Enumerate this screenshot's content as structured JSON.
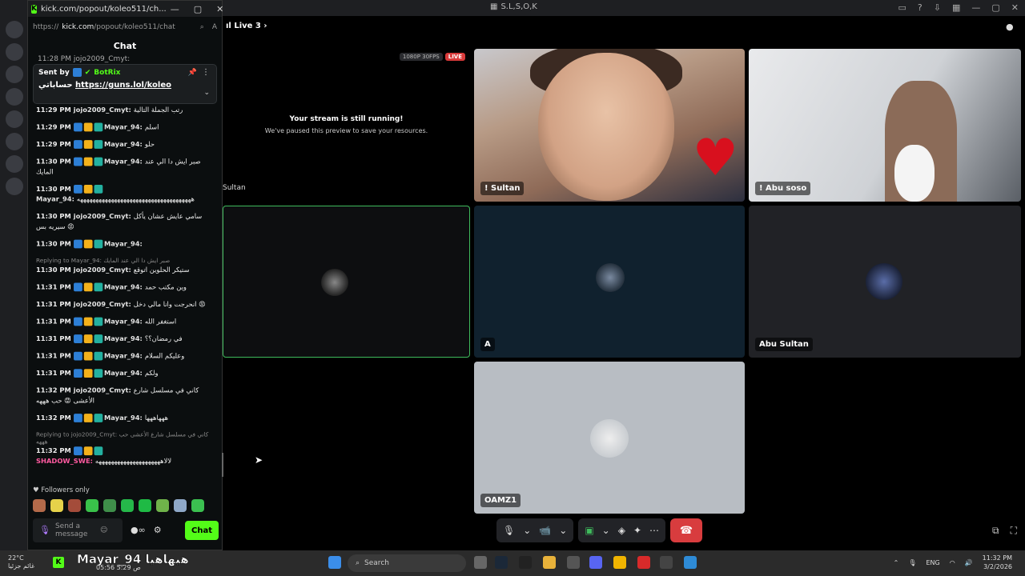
{
  "discord": {
    "window_title": "S.L,S,O,K",
    "channel": "Live 3",
    "stream": {
      "resolution": "1080P 30FPS",
      "live_badge": "LIVE",
      "paused_title": "Your stream is still running!",
      "paused_subtitle": "We've paused this preview to save your resources.",
      "cut_name": "Sultan"
    },
    "tiles": [
      {
        "name": "! Sultan"
      },
      {
        "name": "! Abu soso"
      },
      {
        "name": "A"
      },
      {
        "name": "Abu Sultan"
      },
      {
        "name": "OAMZ1"
      }
    ],
    "controls": {
      "mic": "🎙",
      "mic_more": "⌄",
      "camera": "📹",
      "camera_more": "⌄",
      "share": "▣",
      "share_more": "⌄",
      "activities": "◈",
      "soundboard": "✦",
      "more": "⋯",
      "hangup": "☎"
    }
  },
  "popout": {
    "title": "kick.com/popout/koleo511/ch...",
    "url_prefix": "https://",
    "url_domain": "kick.com",
    "url_path": "/popout/koleo511/chat",
    "chat_heading": "Chat",
    "top_partial": "11:28 PM jojo2009_Cmyt:",
    "pinned": {
      "sent_by": "Sent by",
      "bot": "BotRix",
      "prefix": "حساباتي",
      "link": "https://guns.lol/koleo"
    },
    "messages": [
      {
        "time": "11:29 PM",
        "user": "jojo2009_Cmyt:",
        "text": "رتب الجملة التالية",
        "badges": 0
      },
      {
        "time": "11:29 PM",
        "user": "Mayar_94:",
        "text": "اسلم",
        "badges": 3
      },
      {
        "time": "11:29 PM",
        "user": "Mayar_94:",
        "text": "حلو",
        "badges": 3
      },
      {
        "time": "11:30 PM",
        "user": "Mayar_94:",
        "text": "صبر ايش دا الي عند المايك",
        "badges": 3
      },
      {
        "time": "11:30 PM",
        "user": "Mayar_94:",
        "text": "هههههههههههههههههههههههههههههههههههههه",
        "badges": 3
      },
      {
        "time": "11:30 PM",
        "user": "jojo2009_Cmyt:",
        "text": "سامي عايش عشان يأكل سيريه بس 😡",
        "badges": 0
      },
      {
        "time": "11:30 PM",
        "user": "Mayar_94:",
        "text": "",
        "badges": 3
      },
      {
        "time": "11:30 PM",
        "user": "jojo2009_Cmyt:",
        "text": "ستيكر الحلوين اتوقع",
        "badges": 0,
        "reply": "Replying to Mayar_94: صبر ايش دا الي عند المايك"
      },
      {
        "time": "11:31 PM",
        "user": "Mayar_94:",
        "text": "وين مكتب حمد",
        "badges": 3
      },
      {
        "time": "11:31 PM",
        "user": "jojo2009_Cmyt:",
        "text": "انحرجت وانا مالي دخل 😡",
        "badges": 0
      },
      {
        "time": "11:31 PM",
        "user": "Mayar_94:",
        "text": "استغفر الله",
        "badges": 3
      },
      {
        "time": "11:31 PM",
        "user": "Mayar_94:",
        "text": "في رمضان؟؟",
        "badges": 3
      },
      {
        "time": "11:31 PM",
        "user": "Mayar_94:",
        "text": "وعليكم السلام",
        "badges": 3
      },
      {
        "time": "11:31 PM",
        "user": "Mayar_94:",
        "text": "ولكم",
        "badges": 3
      },
      {
        "time": "11:32 PM",
        "user": "jojo2009_Cmyt:",
        "text": "كاني في مسلسل شارع الأعشى 😡 حب هههه",
        "badges": 0
      },
      {
        "time": "11:32 PM",
        "user": "Mayar_94:",
        "text": "هههاههها",
        "badges": 3
      },
      {
        "time": "11:32 PM",
        "user": "SHADOW_SWE:",
        "text": "لالاهههههههههههههههههههههه",
        "badges": 3,
        "pink": true,
        "reply": "Replying to jojo2009_Cmyt: كاني في مسلسل شارع الأعشى حب هههه"
      }
    ],
    "followers_only": "Followers only",
    "composer_placeholder": "Send a message",
    "chat_button": "Chat"
  },
  "taskbar": {
    "temp": "22°C",
    "weather_sub": "غائم جزئيا",
    "overlay_name": "Mayar_94",
    "overlay_text": "هيهاهيا",
    "overlay_times": [
      "05:56",
      "ص",
      "5:29"
    ],
    "search": "Search",
    "lang": "ENG",
    "time": "11:32 PM",
    "date": "3/2/2026"
  },
  "colors": {
    "kick_green": "#53fc18",
    "live_red": "#d93a3a",
    "hangup_red": "#d83c3e",
    "active_border": "#3fba5c"
  }
}
